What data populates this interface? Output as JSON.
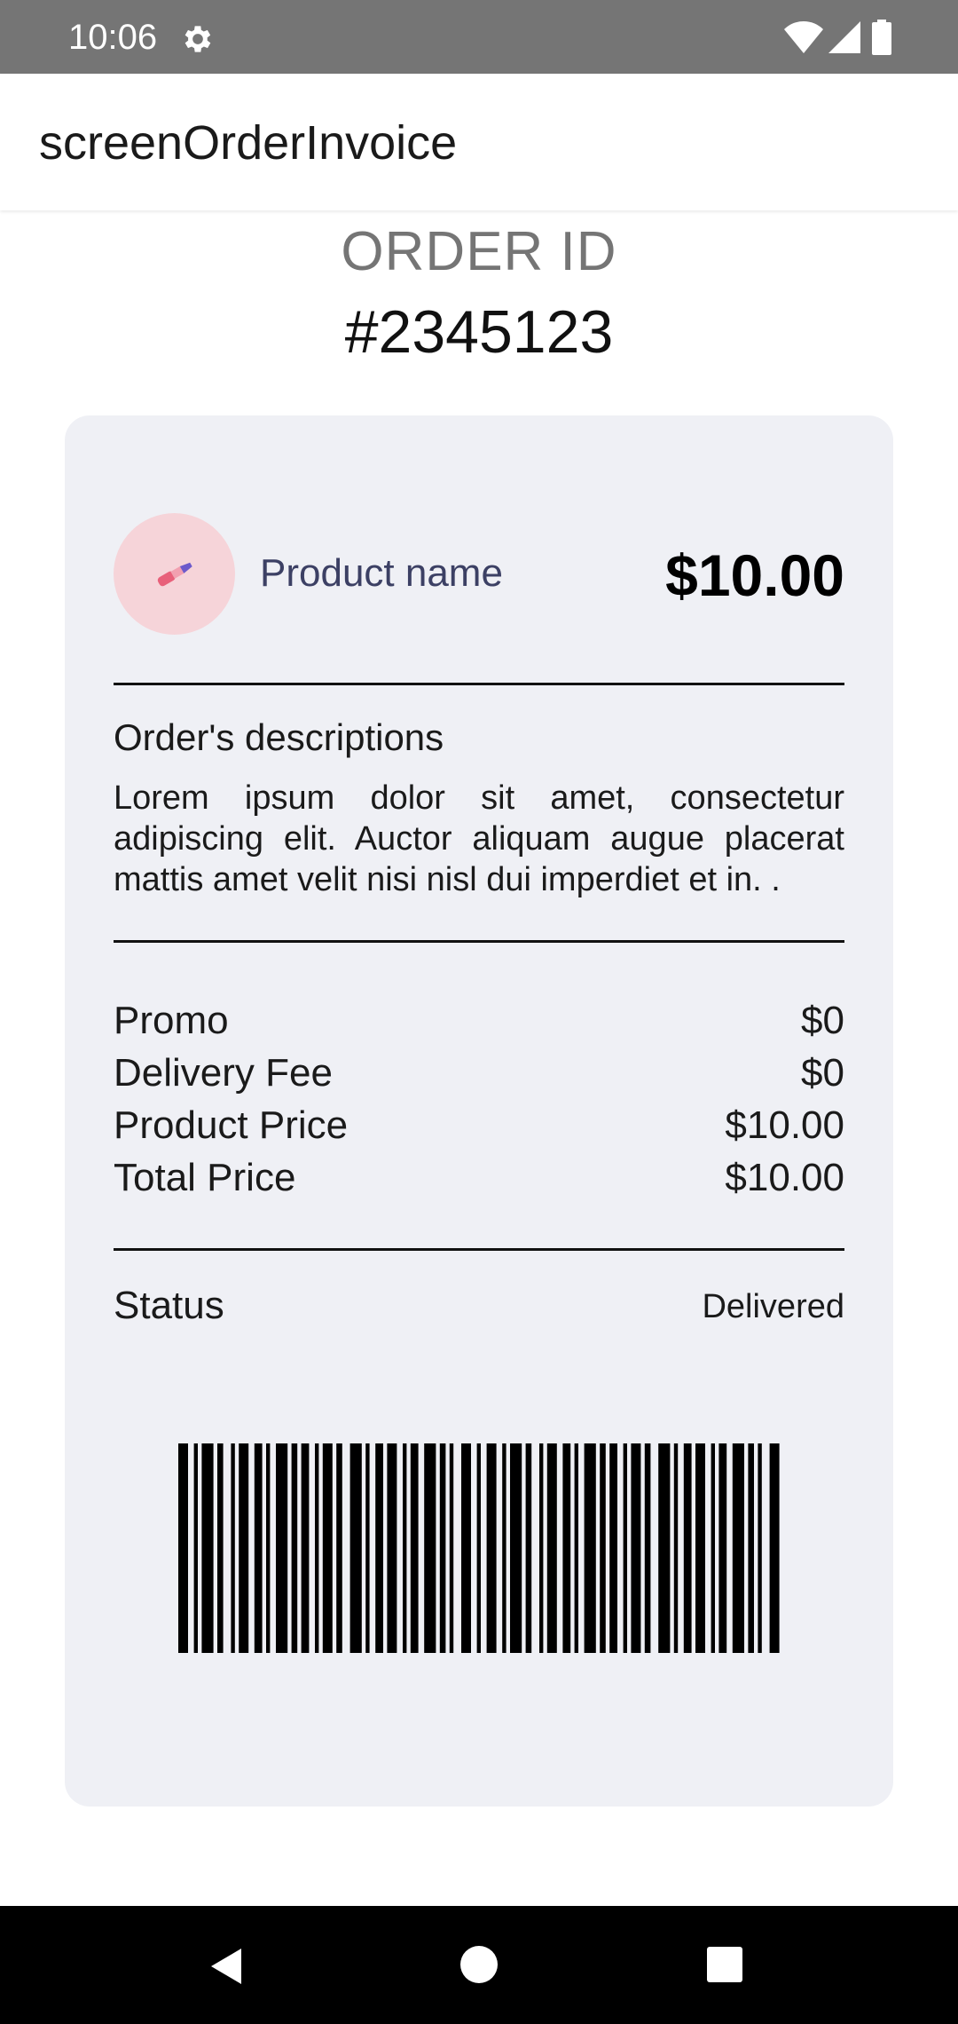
{
  "status_bar": {
    "time": "10:06",
    "icons": [
      "gear-icon",
      "wifi-icon",
      "signal-icon",
      "battery-icon"
    ]
  },
  "app_bar": {
    "title": "screenOrderInvoice"
  },
  "order": {
    "id_label": "ORDER ID",
    "id_value": "#2345123"
  },
  "product": {
    "icon": "lipstick-icon",
    "name": "Product name",
    "price": "$10.00"
  },
  "description": {
    "title": "Order's descriptions",
    "body": "Lorem ipsum dolor sit amet, consectetur adipiscing elit. Auctor aliquam augue placerat mattis amet velit nisi nisl dui imperdiet et in. ."
  },
  "pricing": [
    {
      "label": "Promo",
      "value": "$0"
    },
    {
      "label": "Delivery Fee",
      "value": "$0"
    },
    {
      "label": "Product Price",
      "value": "$10.00"
    },
    {
      "label": "Total Price",
      "value": "$10.00"
    }
  ],
  "status": {
    "label": "Status",
    "value": "Delivered"
  },
  "navigation": {
    "icons": [
      "back-icon",
      "home-icon",
      "recent-apps-icon"
    ]
  },
  "colors": {
    "status_bar": "#757575",
    "card_background": "#eff0f5",
    "product_thumb": "#f6d4d9",
    "product_name": "#3c4064",
    "order_label": "#757575"
  }
}
